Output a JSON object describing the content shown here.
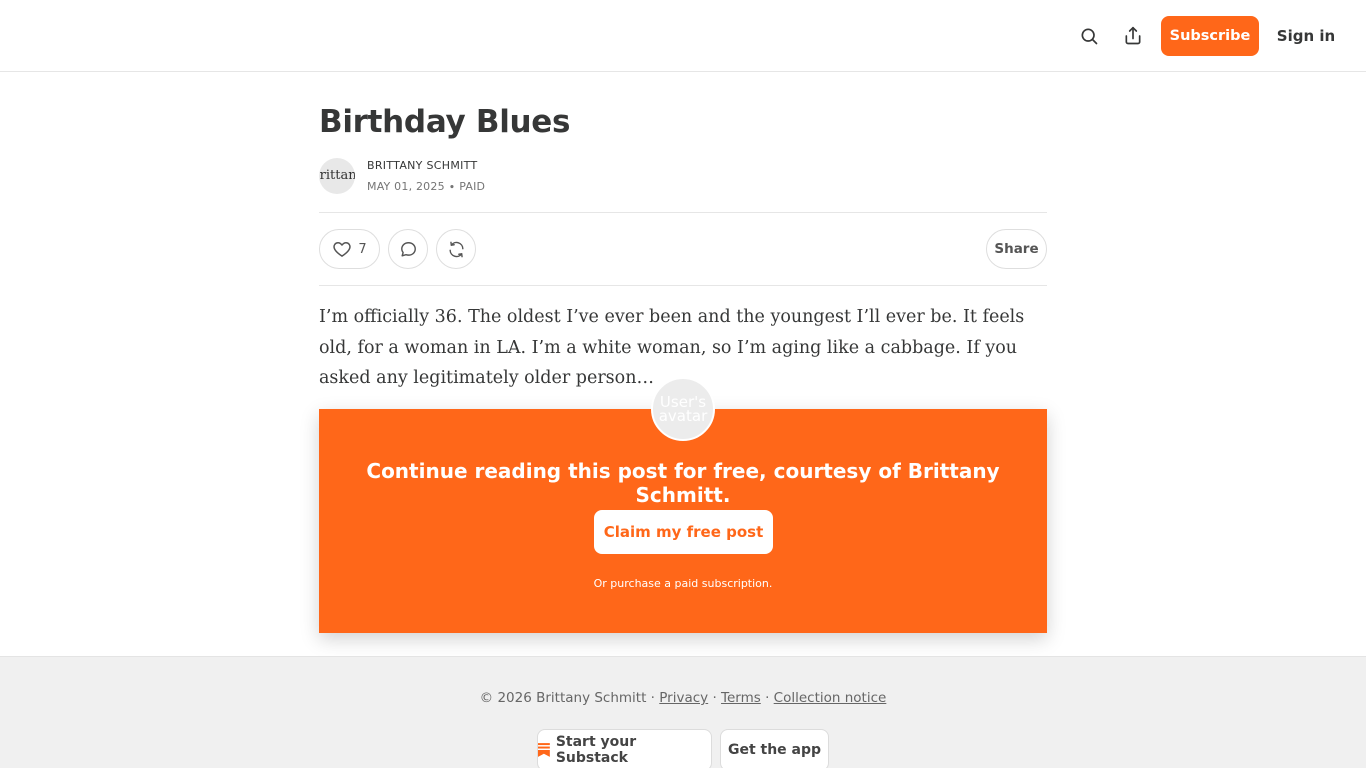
{
  "header": {
    "subscribe_label": "Subscribe",
    "signin_label": "Sign in",
    "accent_color": "#ff6719"
  },
  "post": {
    "title": "Birthday Blues",
    "author_name": "BRITTANY SCHMITT",
    "meta": "MAY 01, 2025 ∙ PAID",
    "author_avatar_alt": "Brittany",
    "like_count": "7",
    "share_label": "Share",
    "excerpt": "I’m officially 36. The oldest I’ve ever been and the youngest I’ll ever be. It feels old, for a woman in LA. I’m a white woman, so I’m aging like a cabbage. If you asked any legitimately older person…"
  },
  "paywall": {
    "avatar_alt": "User's avatar",
    "message": "Continue reading this post for free, courtesy of Brittany Schmitt.",
    "claim_label": "Claim my free post",
    "purchase_label": "Or purchase a paid subscription."
  },
  "footer": {
    "copyright": "© 2026 Brittany Schmitt · ",
    "privacy": "Privacy",
    "sep1": " · ",
    "terms": "Terms",
    "sep2": " · ",
    "collection": "Collection notice",
    "start_label": "Start your Substack",
    "app_label": "Get the app"
  }
}
